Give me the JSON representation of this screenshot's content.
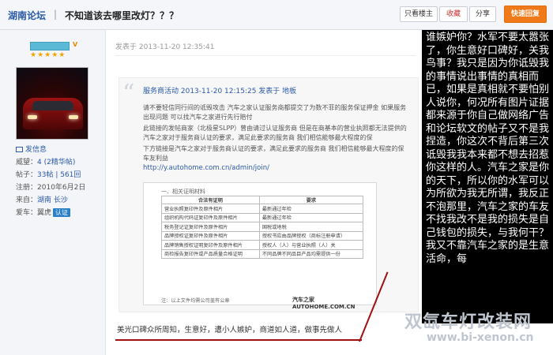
{
  "header": {
    "forum_name": "湖南论坛",
    "separator": "|",
    "title": "不知道该去哪里改灯？？？",
    "buttons": {
      "author_only": "只看楼主",
      "favorite": "收藏",
      "share": "分享",
      "reply": "快速回复"
    }
  },
  "user": {
    "level_badge": "V",
    "stars": "★★★★★",
    "send_message": "发信息",
    "stats": [
      {
        "label": "威望：",
        "value": "4 (2精华帖)",
        "badge": ""
      },
      {
        "label": "帖子：",
        "value": "33帖 | 561回",
        "badge": ""
      },
      {
        "label": "注册：",
        "value": "2010年6月2日",
        "badge": ""
      },
      {
        "label": "来自：",
        "value": "湖南 长沙",
        "badge": ""
      },
      {
        "label": "爱车：",
        "value": "翼虎",
        "badge": "认证"
      }
    ]
  },
  "post": {
    "time": "发表于 2013-11-20 12:35:41",
    "quote": {
      "head": "服务商活动  2013-11-20 12:15:25  发表于 地板",
      "body": [
        "请不要轻信同行间的诋毁攻击 汽车之家认证服务商都提交了为数不菲的服务保证押金 如果服务",
        "出现问题 可以找汽车之家进行先行赔付",
        "此链接的发帖商家（北极星SLPP）曾由请过认证服务商 但是在商基本的营业执照都无法提供的",
        "汽车之家对于服务商认证的要求，满足此要求的服务商 我们相信能够最大程度的保",
        "下方链接是汽车之家对于服务商认证的要求，满足此要求的服务商 我们相信能够最大程度的保",
        "车友利益"
      ],
      "link": "http://y.autohome.com.cn/admin/join/",
      "cert_title": "一、相关证明材料",
      "cert_headers": [
        "合法有证明",
        "要求"
      ],
      "cert_rows": [
        [
          "营业执照复印件及原件相片",
          "最新通过年检"
        ],
        [
          "组织机构代码证复印件及原件相片",
          "最新通过年检"
        ],
        [
          "税务登记证复印件及原件相片",
          "国税或地税"
        ],
        [
          "品牌授权证复印件及原件相片",
          "授权书应由品牌授权（商标注册申请）"
        ],
        [
          "品牌销售授权证明复印件及原件相片",
          "授权人（人）与营业执照（人）关"
        ],
        [
          "商检报告复印件或产品质量合格证明",
          "不同品牌不同品目产品均需提供一份"
        ]
      ],
      "cert_footer": "注：以上文件均需公司盖有公章",
      "cert_watermark": "汽车之家  AUTOHOME.COM.CN"
    },
    "bottom_text": "美光口碑众所周知，生意好，遭小人嫉妒，商道如人道，做事先做人"
  },
  "annotation": "谁嫉妒你？水军不要太嚣张了，你生意好口碑好，关我鸟事？我只是因为你诋毁我的事情说出事情的真相而已，如果是真相就不要怕别人说你，何况所有图片证据都来源于你自己做网络广告和论坛软文的帖子又不是我捏造，你这次不背后第三次诋毁我我本来都不想去招惹你这样的人。汽车之家是你的天下，所以你的水军可以为所欲为我无所谓，我反正不泡那里，汽车之家的车友不找我改不是我的损失是自己钱包的损失，与我何干？我又不靠汽车之家的是生意活命，每",
  "site_watermark": {
    "title": "双氙车灯改装网",
    "url": "www.bi-xenon.cn"
  },
  "colors": {
    "accent_blue": "#2a5aa8",
    "reply_orange": "#f07a1a",
    "annotation_red": "#a01010"
  }
}
